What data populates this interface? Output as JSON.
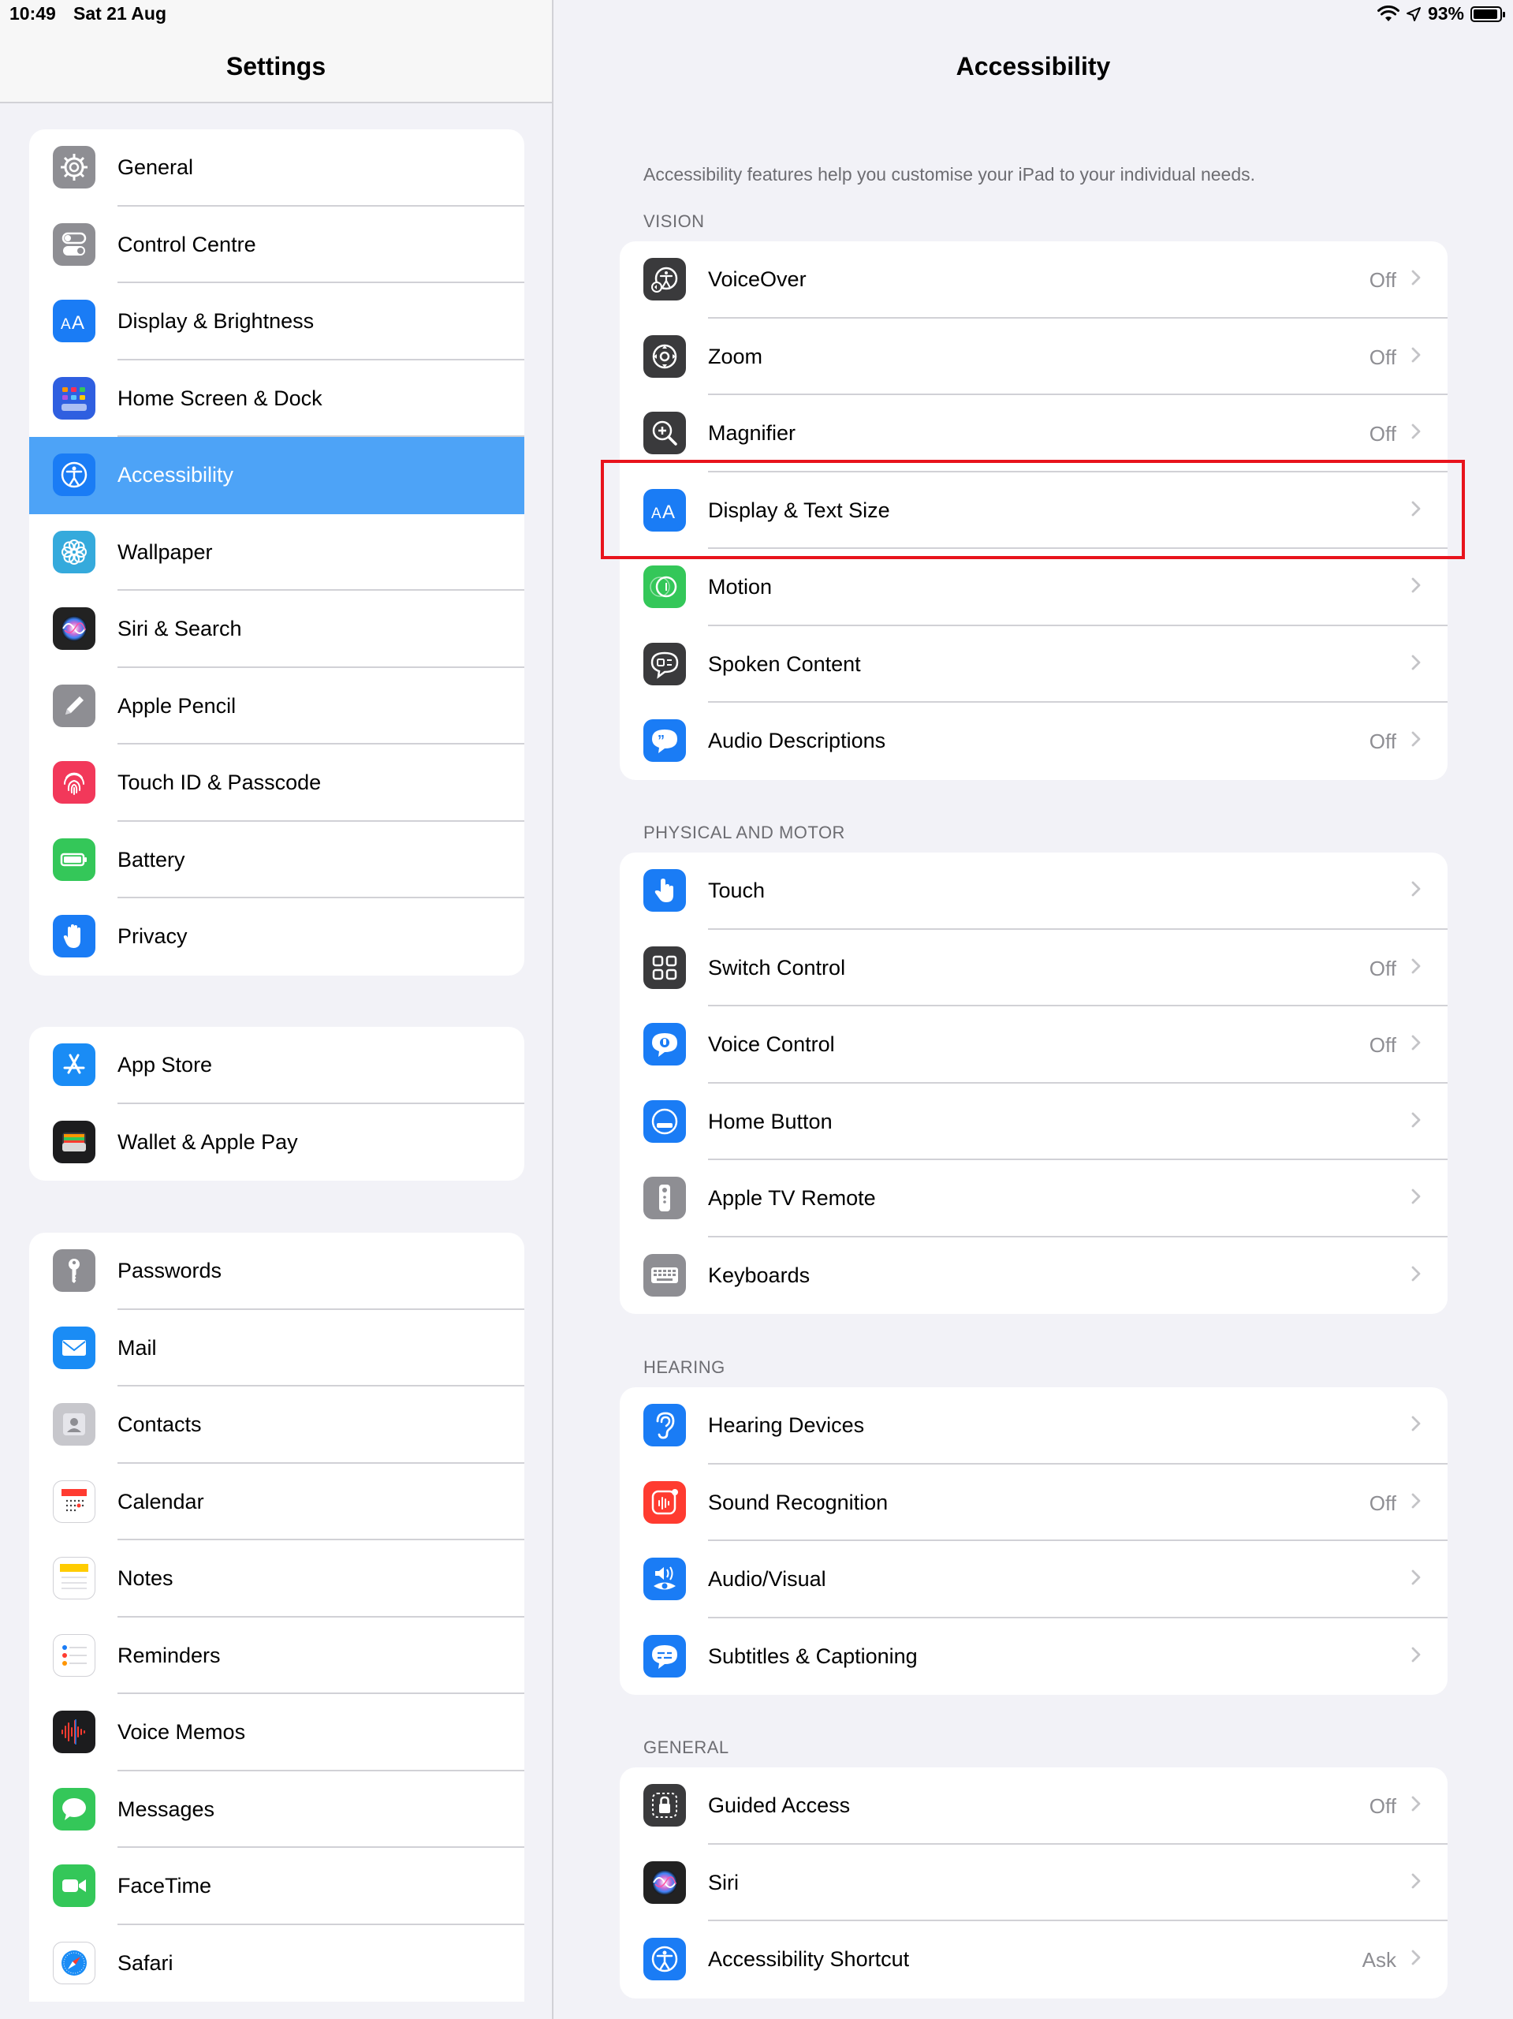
{
  "status": {
    "time": "10:49",
    "date": "Sat 21 Aug",
    "battery": "93%"
  },
  "sidebar": {
    "title": "Settings",
    "groups": [
      [
        {
          "label": "General",
          "icon": "gear-icon",
          "color": "#8e8e93"
        },
        {
          "label": "Control Centre",
          "icon": "toggles-icon",
          "color": "#8e8e93"
        },
        {
          "label": "Display & Brightness",
          "icon": "text-size-icon",
          "color": "#1a7cf5"
        },
        {
          "label": "Home Screen & Dock",
          "icon": "app-grid-icon",
          "color": "#2f5fe0"
        },
        {
          "label": "Accessibility",
          "icon": "accessibility-icon",
          "color": "#1a7cf5",
          "selected": true
        },
        {
          "label": "Wallpaper",
          "icon": "flower-icon",
          "color": "#35aadc"
        },
        {
          "label": "Siri & Search",
          "icon": "siri-icon",
          "color": "#222222"
        },
        {
          "label": "Apple Pencil",
          "icon": "pencil-icon",
          "color": "#8e8e93"
        },
        {
          "label": "Touch ID & Passcode",
          "icon": "fingerprint-icon",
          "color": "#f2385a"
        },
        {
          "label": "Battery",
          "icon": "battery-icon",
          "color": "#34c759"
        },
        {
          "label": "Privacy",
          "icon": "hand-icon",
          "color": "#1a7cf5"
        }
      ],
      [
        {
          "label": "App Store",
          "icon": "app-store-icon",
          "color": "#1a8cf5"
        },
        {
          "label": "Wallet & Apple Pay",
          "icon": "wallet-icon",
          "color": "#1c1c1e"
        }
      ],
      [
        {
          "label": "Passwords",
          "icon": "key-icon",
          "color": "#8e8e93"
        },
        {
          "label": "Mail",
          "icon": "mail-icon",
          "color": "#1a8cf5"
        },
        {
          "label": "Contacts",
          "icon": "contacts-icon",
          "color": "#c7c7cc"
        },
        {
          "label": "Calendar",
          "icon": "calendar-icon",
          "color": "#ffffff"
        },
        {
          "label": "Notes",
          "icon": "notes-icon",
          "color": "#ffffff"
        },
        {
          "label": "Reminders",
          "icon": "reminders-icon",
          "color": "#ffffff"
        },
        {
          "label": "Voice Memos",
          "icon": "voice-memos-icon",
          "color": "#1c1c1e"
        },
        {
          "label": "Messages",
          "icon": "messages-icon",
          "color": "#34c759"
        },
        {
          "label": "FaceTime",
          "icon": "facetime-icon",
          "color": "#34c759"
        },
        {
          "label": "Safari",
          "icon": "safari-icon",
          "color": "#ffffff"
        }
      ]
    ]
  },
  "detail": {
    "title": "Accessibility",
    "intro": "Accessibility features help you customise your iPad to your individual needs.",
    "sections": [
      {
        "header": "VISION",
        "rows": [
          {
            "label": "VoiceOver",
            "value": "Off",
            "icon": "voiceover-icon",
            "color": "#3a3a3c"
          },
          {
            "label": "Zoom",
            "value": "Off",
            "icon": "zoom-icon",
            "color": "#3a3a3c"
          },
          {
            "label": "Magnifier",
            "value": "Off",
            "icon": "magnifier-icon",
            "color": "#3a3a3c"
          },
          {
            "label": "Display & Text Size",
            "value": "",
            "icon": "text-size-icon",
            "color": "#1a7cf5"
          },
          {
            "label": "Motion",
            "value": "",
            "icon": "motion-icon",
            "color": "#34c759"
          },
          {
            "label": "Spoken Content",
            "value": "",
            "icon": "spoken-content-icon",
            "color": "#3a3a3c"
          },
          {
            "label": "Audio Descriptions",
            "value": "Off",
            "icon": "audio-descriptions-icon",
            "color": "#1a7cf5"
          }
        ]
      },
      {
        "header": "PHYSICAL AND MOTOR",
        "rows": [
          {
            "label": "Touch",
            "value": "",
            "icon": "touch-icon",
            "color": "#1a7cf5"
          },
          {
            "label": "Switch Control",
            "value": "Off",
            "icon": "switch-control-icon",
            "color": "#3a3a3c"
          },
          {
            "label": "Voice Control",
            "value": "Off",
            "icon": "voice-control-icon",
            "color": "#1a7cf5"
          },
          {
            "label": "Home Button",
            "value": "",
            "icon": "home-button-icon",
            "color": "#1a7cf5"
          },
          {
            "label": "Apple TV Remote",
            "value": "",
            "icon": "tv-remote-icon",
            "color": "#8e8e93"
          },
          {
            "label": "Keyboards",
            "value": "",
            "icon": "keyboard-icon",
            "color": "#8e8e93"
          }
        ]
      },
      {
        "header": "HEARING",
        "rows": [
          {
            "label": "Hearing Devices",
            "value": "",
            "icon": "ear-icon",
            "color": "#1a7cf5"
          },
          {
            "label": "Sound Recognition",
            "value": "Off",
            "icon": "sound-recognition-icon",
            "color": "#ff3b30"
          },
          {
            "label": "Audio/Visual",
            "value": "",
            "icon": "audio-visual-icon",
            "color": "#1a7cf5"
          },
          {
            "label": "Subtitles & Captioning",
            "value": "",
            "icon": "captions-icon",
            "color": "#1a7cf5"
          }
        ]
      },
      {
        "header": "GENERAL",
        "rows": [
          {
            "label": "Guided Access",
            "value": "Off",
            "icon": "guided-access-icon",
            "color": "#3a3a3c"
          },
          {
            "label": "Siri",
            "value": "",
            "icon": "siri-icon",
            "color": "#222222"
          },
          {
            "label": "Accessibility Shortcut",
            "value": "Ask",
            "icon": "accessibility-icon",
            "color": "#1a7cf5"
          }
        ]
      }
    ]
  }
}
